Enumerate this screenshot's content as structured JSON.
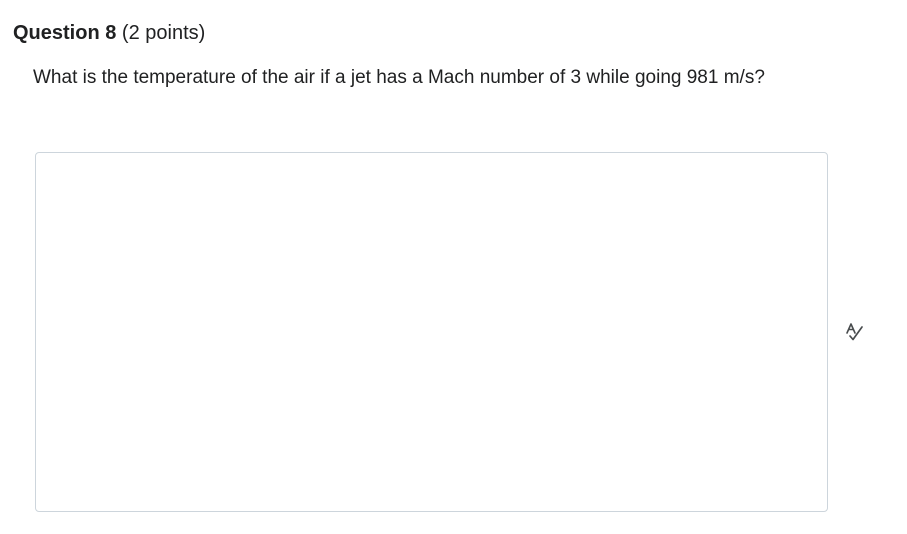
{
  "question": {
    "title": "Question 8",
    "points": "(2 points)",
    "text": "What is the temperature of the air if a jet has a Mach number of 3 while going 981 m/s?"
  },
  "answer": {
    "value": "",
    "placeholder": ""
  },
  "icons": {
    "spellcheck": "spellcheck-icon"
  },
  "colors": {
    "text": "#202122",
    "border": "#cdd5dc"
  }
}
